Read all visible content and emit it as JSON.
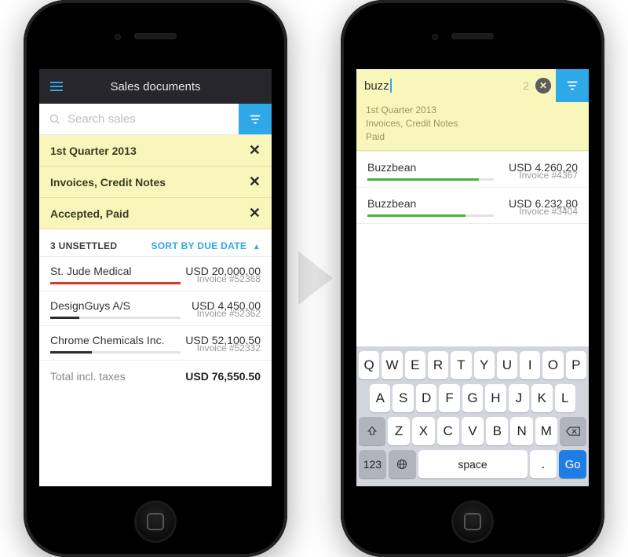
{
  "screenA": {
    "header": {
      "title": "Sales documents"
    },
    "search": {
      "placeholder": "Search sales"
    },
    "chips": [
      {
        "label": "1st Quarter 2013"
      },
      {
        "label": "Invoices, Credit Notes"
      },
      {
        "label": "Accepted, Paid"
      }
    ],
    "section": {
      "count_label": "3 UNSETTLED",
      "sort_label": "SORT BY DUE DATE",
      "sort_arrow": "▲"
    },
    "items": [
      {
        "name": "St. Jude Medical",
        "amount": "USD 20,000.00",
        "invoice": "Invoice #52368",
        "bar_color": "#d23a2c",
        "bar_pct": 100
      },
      {
        "name": "DesignGuys A/S",
        "amount": "USD 4,450.00",
        "invoice": "Invoice #52362",
        "bar_color": "#2c2c2c",
        "bar_pct": 22
      },
      {
        "name": "Chrome Chemicals Inc.",
        "amount": "USD 52,100.50",
        "invoice": "Invoice #52332",
        "bar_color": "#2c2c2c",
        "bar_pct": 32
      }
    ],
    "total": {
      "label": "Total incl. taxes",
      "amount": "USD 76,550.50"
    }
  },
  "screenB": {
    "search": {
      "value": "buzz",
      "count": "2"
    },
    "filters": {
      "period": "1st Quarter 2013",
      "types": "Invoices, Credit Notes",
      "status": "Paid"
    },
    "items": [
      {
        "name": "Buzzbean",
        "amount": "USD 4.260,20",
        "invoice": "Invoice #4367",
        "bar_pct": 88
      },
      {
        "name": "Buzzbean",
        "amount": "USD 6.232,80",
        "invoice": "Invoice #3404",
        "bar_pct": 78
      }
    ],
    "keyboard": {
      "row1": [
        "Q",
        "W",
        "E",
        "R",
        "T",
        "Y",
        "U",
        "I",
        "O",
        "P"
      ],
      "row2": [
        "A",
        "S",
        "D",
        "F",
        "G",
        "H",
        "J",
        "K",
        "L"
      ],
      "row3": [
        "Z",
        "X",
        "C",
        "V",
        "B",
        "N",
        "M"
      ],
      "num": "123",
      "space": "space",
      "dot": ".",
      "go": "Go"
    }
  }
}
